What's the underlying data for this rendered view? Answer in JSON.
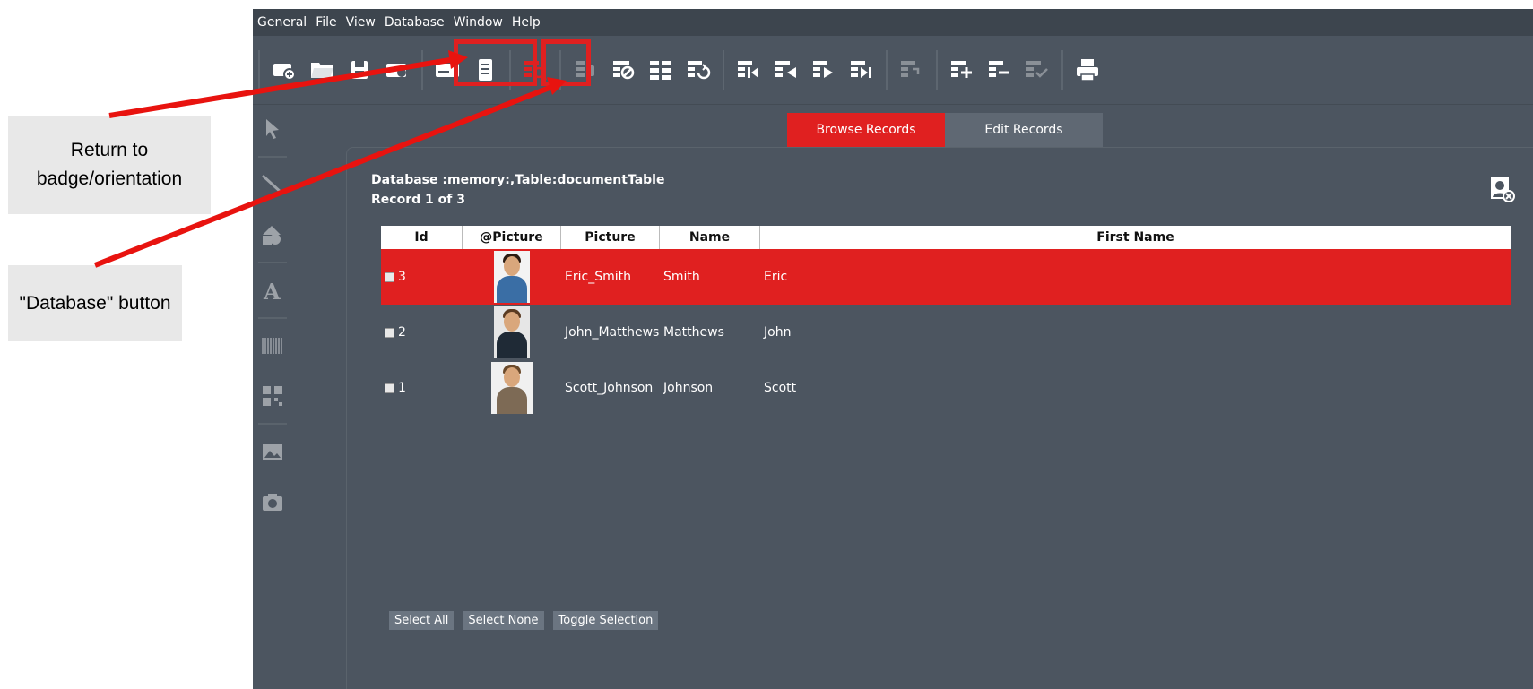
{
  "menu": [
    "General",
    "File",
    "View",
    "Database",
    "Window",
    "Help"
  ],
  "toolbar": {
    "icons": [
      "new-document-icon",
      "open-folder-icon",
      "save-icon",
      "save-as-icon",
      "badge-landscape-icon",
      "badge-portrait-icon",
      "database-search-icon",
      "database-connect-icon",
      "database-disconnect-icon",
      "database-table-icon",
      "database-refresh-icon",
      "first-record-icon",
      "previous-record-icon",
      "next-record-icon",
      "last-record-icon",
      "undo-record-icon",
      "add-record-icon",
      "delete-record-icon",
      "commit-record-icon",
      "print-icon"
    ]
  },
  "tabs": {
    "browse": "Browse Records",
    "edit": "Edit Records"
  },
  "db": {
    "line1": "Database :memory:,Table:documentTable",
    "line2": "Record 1 of 3"
  },
  "table": {
    "headers": [
      "Id",
      "@Picture",
      "Picture",
      "Name",
      "First Name"
    ],
    "rows": [
      {
        "id": "3",
        "picture": "Eric_Smith",
        "name": "Smith",
        "first": "Eric"
      },
      {
        "id": "2",
        "picture": "John_Matthews",
        "name": "Matthews",
        "first": "John"
      },
      {
        "id": "1",
        "picture": "Scott_Johnson",
        "name": "Johnson",
        "first": "Scott"
      }
    ]
  },
  "buttons": {
    "select_all": "Select All",
    "select_none": "Select None",
    "toggle": "Toggle Selection"
  },
  "callouts": {
    "return_badge": "Return to badge/orientation",
    "database_button": "\"Database\" button"
  },
  "colors": {
    "accent": "#e02020",
    "app_bg": "#4c5560",
    "menubar": "#3d454e"
  }
}
